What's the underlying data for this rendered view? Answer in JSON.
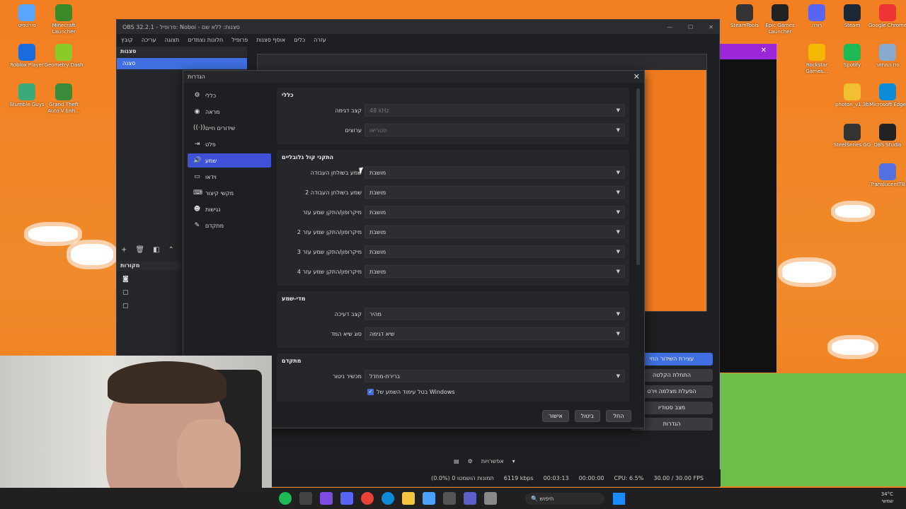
{
  "desktop_icons": [
    {
      "label": "פורטנייט",
      "color": "#5aa5ff",
      "icon": "fortnite-icon"
    },
    {
      "label": "Minecraft Launcher",
      "color": "#3a8a2a",
      "icon": "minecraft-icon"
    },
    {
      "label": "Roblox Player",
      "color": "#1a6ae0",
      "icon": "roblox-icon"
    },
    {
      "label": "Geometry Dash",
      "color": "#8acb2a",
      "icon": "geometry-dash-icon"
    },
    {
      "label": "Stumble Guys",
      "color": "#3aaa7a",
      "icon": "stumble-guys-icon"
    },
    {
      "label": "Grand Theft Auto V Enh...",
      "color": "#3a8a3a",
      "icon": "gta-icon"
    },
    {
      "label": "SteamTools",
      "color": "#333",
      "icon": "steamtools-icon"
    },
    {
      "label": "Epic Games Launcher",
      "color": "#222",
      "icon": "epic-icon"
    },
    {
      "label": "רורה",
      "color": "#5865f2",
      "icon": "discord-icon"
    },
    {
      "label": "Steam",
      "color": "#1b2838",
      "icon": "steam-icon"
    },
    {
      "label": "Google Chrome",
      "color": "#e33",
      "icon": "chrome-icon"
    },
    {
      "label": "Rockstar Games...",
      "color": "#f5b800",
      "icon": "rockstar-icon"
    },
    {
      "label": "Spotify",
      "color": "#1db954",
      "icon": "spotify-icon"
    },
    {
      "label": "פח המחזור",
      "color": "#88aacc",
      "icon": "recycle-bin-icon"
    },
    {
      "label": "photon_v1.3b",
      "color": "#f0c030",
      "icon": "folder-icon"
    },
    {
      "label": "Microsoft Edge",
      "color": "#0b8bd8",
      "icon": "edge-icon"
    },
    {
      "label": "SteelSeries GG",
      "color": "#333",
      "icon": "steelseries-icon"
    },
    {
      "label": "OBS Studio",
      "color": "#222",
      "icon": "obs-icon"
    },
    {
      "label": "TranslucentTB",
      "color": "#5570e0",
      "icon": "translucenttb-icon"
    }
  ],
  "obs": {
    "title": "OBS 32.2.1 - פרופיל: Noboi - סצנות: ללא שם",
    "menu": [
      "קובץ",
      "עריכה",
      "תצוגה",
      "חלונות נצמדים",
      "פרופיל",
      "אוסף סצנות",
      "כלים",
      "עזרה"
    ],
    "scenes_title": "סצנות",
    "scene_item": "סצנה",
    "sources_title": "מקורות",
    "controls": [
      "עצירת השידור החי",
      "התחלת הקלטה",
      "הפעלת מצלמה וירט",
      "מצב סטודיו",
      "הגדרות"
    ],
    "mixer_options": "אפשרויות",
    "status": {
      "frames": "(0.0%) 0 תמונות הושמטו",
      "bitrate": "6119 kbps",
      "stream_time": "00:03:13",
      "rec_time": "00:00:00",
      "cpu": "CPU: 6.5%",
      "fps": "30.00 / 30.00 FPS"
    }
  },
  "settings": {
    "title": "הגדרות",
    "nav": [
      {
        "label": "כללי",
        "icon": "gear-icon",
        "glyph": "⚙"
      },
      {
        "label": "מראה",
        "icon": "palette-icon",
        "glyph": "◉"
      },
      {
        "label": "שידורים חיים",
        "icon": "broadcast-icon",
        "glyph": "((·))"
      },
      {
        "label": "פלט",
        "icon": "output-icon",
        "glyph": "⇥"
      },
      {
        "label": "שמע",
        "icon": "speaker-icon",
        "glyph": "🔊"
      },
      {
        "label": "וידאו",
        "icon": "monitor-icon",
        "glyph": "▭"
      },
      {
        "label": "מקשי קיצור",
        "icon": "keyboard-icon",
        "glyph": "⌨"
      },
      {
        "label": "נגישות",
        "icon": "accessibility-icon",
        "glyph": "☻"
      },
      {
        "label": "מתקדם",
        "icon": "wrench-icon",
        "glyph": "✎"
      }
    ],
    "active_nav": 4,
    "groups": {
      "general": {
        "title": "כללי",
        "rows": [
          {
            "label": "קצב דגימה",
            "value": "48 kHz",
            "disabled": true
          },
          {
            "label": "ערוצים",
            "value": "סטריאו",
            "disabled": true
          }
        ]
      },
      "global": {
        "title": "התקני קול גלובליים",
        "rows": [
          {
            "label": "שמע בשולחן העבודה",
            "value": "מושבת"
          },
          {
            "label": "שמע בשולחן העבודה 2",
            "value": "מושבת"
          },
          {
            "label": "מיקרופון/התקן שמע עזר",
            "value": "מושבת"
          },
          {
            "label": "מיקרופון/התקן שמע עזר 2",
            "value": "מושבת"
          },
          {
            "label": "מיקרופון/התקן שמע עזר 3",
            "value": "מושבת"
          },
          {
            "label": "מיקרופון/התקן שמע עזר 4",
            "value": "מושבת"
          }
        ]
      },
      "meters": {
        "title": "מדי-שמע",
        "rows": [
          {
            "label": "קצב דעיכה",
            "value": "מהיר"
          },
          {
            "label": "סוג שיא המד",
            "value": "שיא דגימה"
          }
        ]
      },
      "advanced": {
        "title": "מתקדם",
        "rows": [
          {
            "label": "מכשיר ניטור",
            "value": "ברירת-מחדל"
          }
        ],
        "checkbox": "בטל עימוד השמע של Windows"
      }
    },
    "buttons": {
      "ok": "אישור",
      "cancel": "ביטול",
      "apply": "החל"
    }
  },
  "taskbar": {
    "search": "חיפוש",
    "weather_temp": "34°C",
    "weather_desc": "שמשי"
  }
}
